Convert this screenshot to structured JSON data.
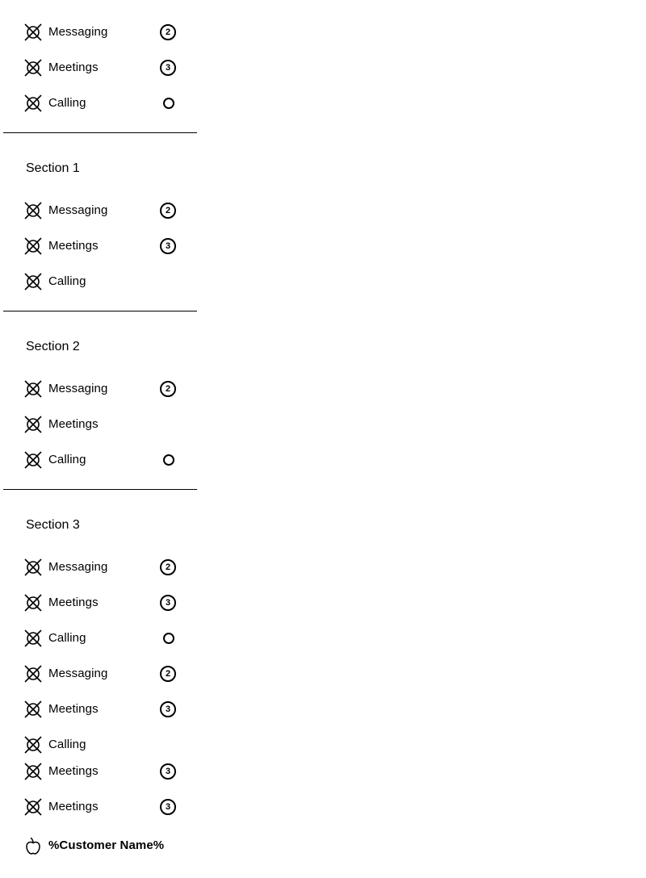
{
  "nav": {
    "top_items": [
      {
        "label": "Messaging",
        "badge": "2"
      },
      {
        "label": "Meetings",
        "badge": "3"
      },
      {
        "label": "Calling",
        "badge": ""
      }
    ],
    "sections": [
      {
        "title": "Section 1",
        "items": [
          {
            "label": "Messaging",
            "badge": "2"
          },
          {
            "label": "Meetings",
            "badge": "3"
          },
          {
            "label": "Calling",
            "badge": ""
          }
        ]
      },
      {
        "title": "Section 2",
        "items": [
          {
            "label": "Messaging",
            "badge": "2"
          },
          {
            "label": "Meetings",
            "badge": ""
          },
          {
            "label": "Calling",
            "badge": ""
          }
        ]
      },
      {
        "title": "Section 3",
        "items": [
          {
            "label": "Messaging",
            "badge": "2"
          },
          {
            "label": "Meetings",
            "badge": "3"
          },
          {
            "label": "Calling",
            "badge": ""
          },
          {
            "label": "Messaging",
            "badge": "2"
          },
          {
            "label": "Meetings",
            "badge": "3"
          },
          {
            "label": "Calling",
            "badge": ""
          },
          {
            "label": "Meetings",
            "badge": "3"
          },
          {
            "label": "Meetings",
            "badge": "3"
          }
        ]
      }
    ],
    "footer": {
      "label": "%Customer Name%",
      "icon": "apple-icon"
    },
    "item_icon": "placeholder-icon",
    "indicator_icon": "status-ring-icon"
  }
}
